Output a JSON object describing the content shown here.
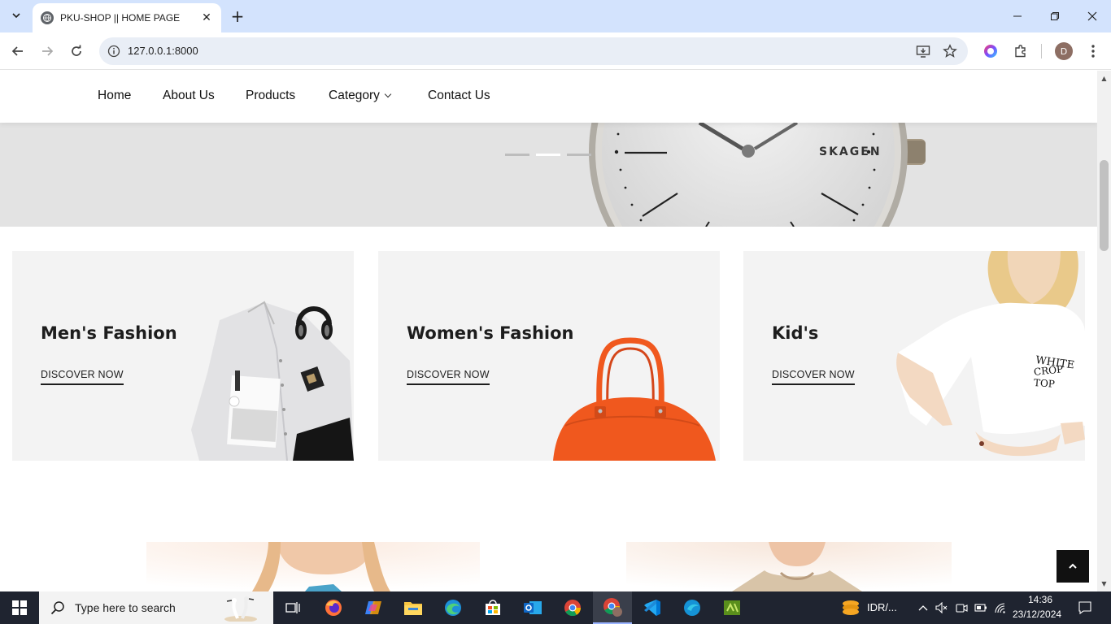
{
  "browser": {
    "tab_title": "PKU-SHOP || HOME PAGE",
    "url": "127.0.0.1:8000",
    "profile_initial": "D"
  },
  "site": {
    "nav": [
      "Home",
      "About Us",
      "Products",
      "Category",
      "Contact Us"
    ],
    "hero": {
      "brand": "SKAGEN",
      "slides_total": 3,
      "active_slide": 2
    },
    "banners": [
      {
        "title": "Men's Fashion",
        "link": "DISCOVER NOW"
      },
      {
        "title": "Women's Fashion",
        "link": "DISCOVER NOW"
      },
      {
        "title": "Kid's",
        "link": "DISCOVER NOW",
        "shirt_text": "WHITE CROP TOP"
      }
    ]
  },
  "taskbar": {
    "search_placeholder": "Type here to search",
    "currency": "IDR/...",
    "time": "14:36",
    "date": "23/12/2024"
  },
  "colors": {
    "tabstrip": "#d3e3fd",
    "banner_bg": "#f3f3f3",
    "bag": "#f0581e",
    "taskbar": "#1f2430"
  }
}
